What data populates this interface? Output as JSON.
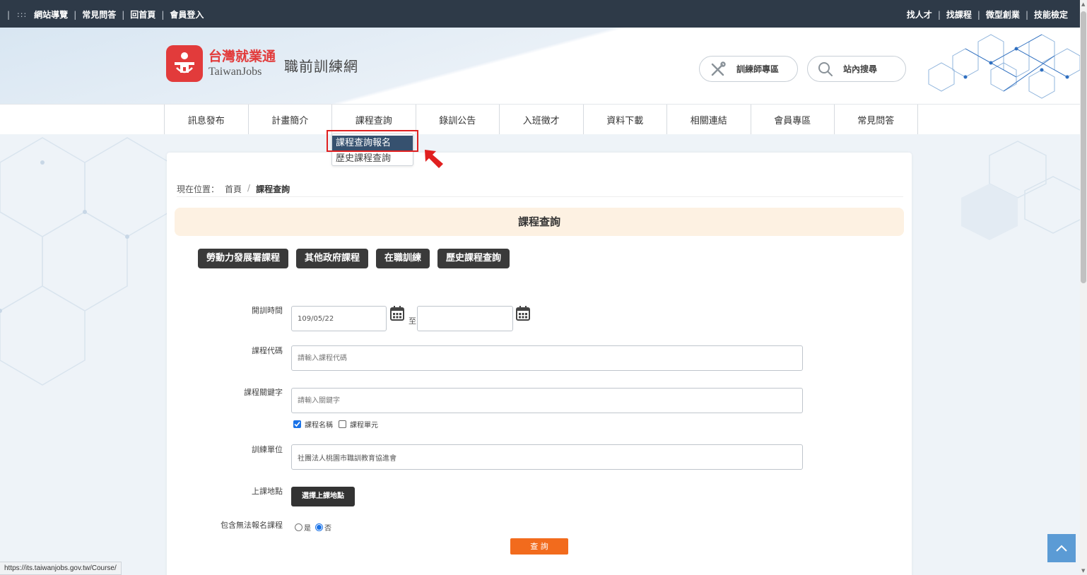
{
  "topbar": {
    "accesskey": ":::",
    "left_links": [
      "網站導覽",
      "常見問答",
      "回首頁",
      "會員登入"
    ],
    "right_links": [
      "找人才",
      "找課程",
      "微型創業",
      "技能檢定"
    ]
  },
  "header": {
    "logo_zh": "台灣就業通",
    "logo_en": "TaiwanJobs",
    "site_name": "職前訓練網",
    "trainer_button": "訓練師專區",
    "search_button": "站內搜尋"
  },
  "nav": {
    "items": [
      "訊息發布",
      "計畫簡介",
      "課程查詢",
      "錄訓公告",
      "入班徵才",
      "資料下載",
      "相關連結",
      "會員專區",
      "常見問答"
    ],
    "dropdown": [
      "課程查詢報名",
      "歷史課程查詢"
    ]
  },
  "breadcrumb": {
    "label": "現在位置：",
    "home": "首頁",
    "separator": "/",
    "current": "課程查詢"
  },
  "page_title": "課程查詢",
  "tabs": [
    "勞動力發展署課程",
    "其他政府課程",
    "在職訓練",
    "歷史課程查詢"
  ],
  "form": {
    "start_date_label": "開訓時間",
    "start_date_value": "109/05/22",
    "to_label": "至",
    "end_date_value": "",
    "course_code_label": "課程代碼",
    "course_code_placeholder": "請輸入課程代碼",
    "keyword_label": "課程關鍵字",
    "keyword_placeholder": "請輸入關鍵字",
    "check_course_name": "課程名稱",
    "check_course_unit": "課程單元",
    "course_name_checked": true,
    "course_unit_checked": false,
    "training_unit_label": "訓練單位",
    "training_unit_value": "社團法人桃園市職訓教育協進會",
    "location_label": "上課地點",
    "location_button": "選擇上課地點",
    "include_label": "包含無法報名課程",
    "radio_yes": "是",
    "radio_no": "否",
    "selected_radio": "否",
    "query_button": "查 詢"
  },
  "status_url": "https://its.taiwanjobs.gov.tw/Course/",
  "colors": {
    "topbar": "#2e3a48",
    "brand_red": "#e23b3b",
    "dropdown_active": "#36516f",
    "highlight": "#e02020",
    "title_bg": "#fdf1e2",
    "tab_bg": "#3a3a3a",
    "query_btn": "#f26b1d",
    "to_top": "#5b9bd5"
  }
}
